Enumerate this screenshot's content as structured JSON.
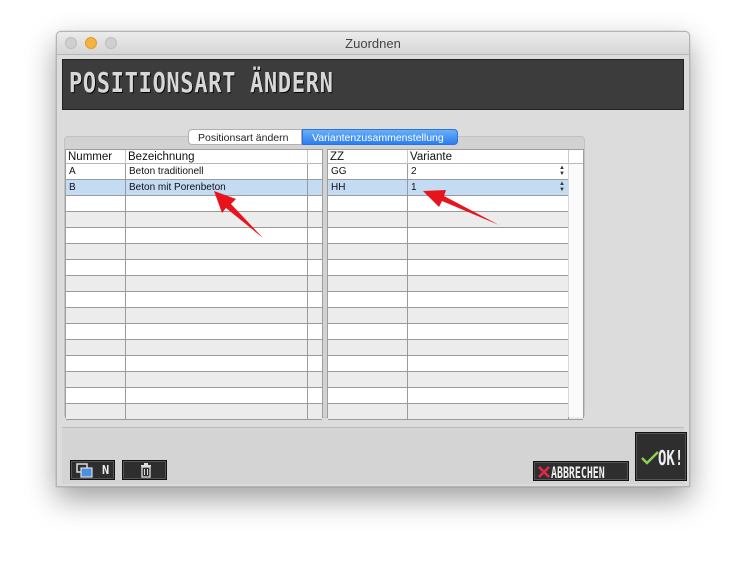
{
  "window": {
    "title": "Zuordnen"
  },
  "banner": {
    "title": "POSITIONSART ÄNDERN"
  },
  "tabs": [
    {
      "label": "Positionsart ändern",
      "active": false
    },
    {
      "label": "Variantenzusammenstellung",
      "active": true
    }
  ],
  "left_table": {
    "columns": [
      "Nummer",
      "Bezeichnung"
    ],
    "rows": [
      {
        "nummer": "A",
        "bezeichnung": "Beton traditionell",
        "selected": false
      },
      {
        "nummer": "B",
        "bezeichnung": "Beton mit Porenbeton",
        "selected": true
      }
    ]
  },
  "right_table": {
    "columns": [
      "ZZ",
      "Variante"
    ],
    "rows": [
      {
        "zz": "GG",
        "variante": "2",
        "selected": false
      },
      {
        "zz": "HH",
        "variante": "1",
        "selected": true
      }
    ]
  },
  "buttons": {
    "new_label": "N",
    "cancel_label": "ABBRECHEN",
    "ok_label": "OK!"
  },
  "icons": {
    "new": "new-record-icon",
    "trash": "trash-icon",
    "cancel": "x-mark-icon",
    "ok": "checkmark-icon",
    "stepper": "up-down-stepper-icon",
    "annotation": "red-arrow-icon"
  },
  "colors": {
    "selected_row": "#c4dbf4",
    "tab_active": "#2a7ff0",
    "banner_bg": "#3c3c3c",
    "cancel_x": "#e0284d",
    "ok_check": "#8fd14f",
    "annotation_arrow": "#e8141c"
  }
}
